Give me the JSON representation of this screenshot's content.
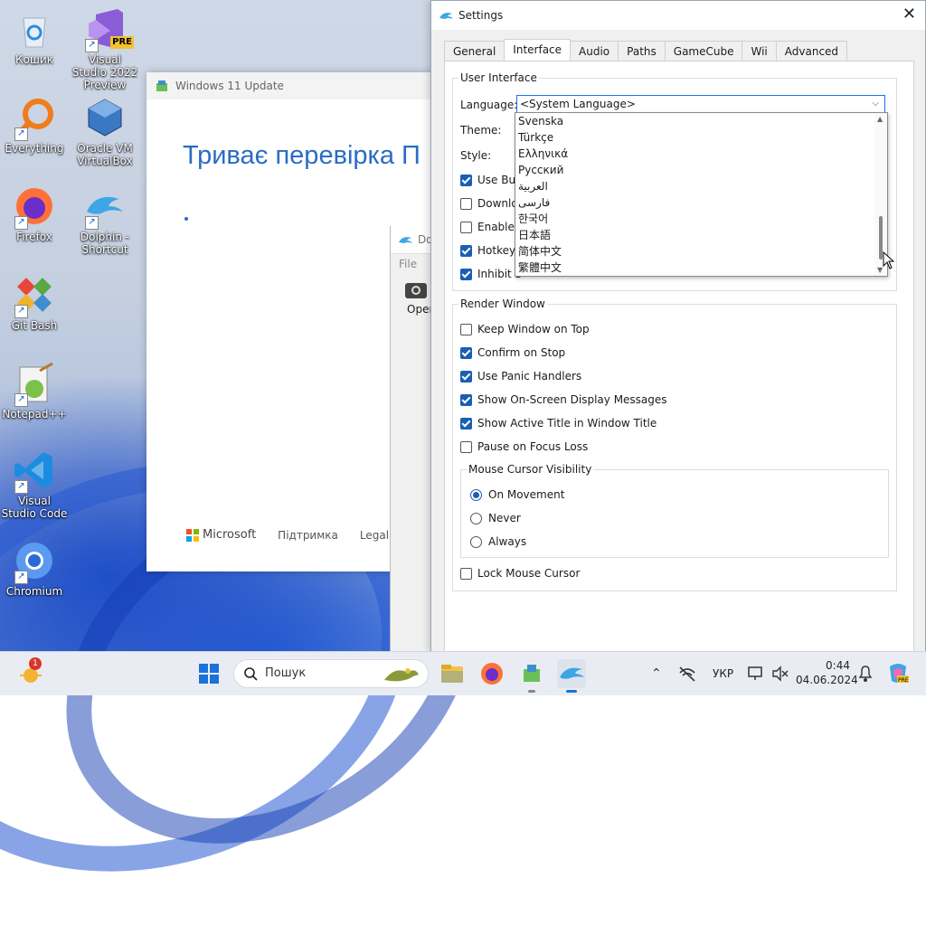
{
  "desktop": {
    "icons": [
      {
        "label": "Кошик",
        "icon": "recycle-bin-icon"
      },
      {
        "label": "Visual Studio 2022 Preview",
        "icon": "visual-studio-icon",
        "badge": "PRE"
      },
      {
        "label": "Everything",
        "icon": "everything-icon"
      },
      {
        "label": "Oracle VM VirtualBox",
        "icon": "virtualbox-icon"
      },
      {
        "label": "Firefox",
        "icon": "firefox-icon"
      },
      {
        "label": "Dolphin - Shortcut",
        "icon": "dolphin-icon"
      },
      {
        "label": "Git Bash",
        "icon": "git-bash-icon"
      },
      {
        "label": "Notepad++",
        "icon": "notepad-plus-plus-icon"
      },
      {
        "label": "Visual Studio Code",
        "icon": "vscode-icon"
      },
      {
        "label": "Chromium",
        "icon": "chromium-icon"
      }
    ]
  },
  "windows11_update": {
    "title": "Windows 11 Update",
    "heading": "Триває перевірка П",
    "footer": {
      "microsoft": "Microsoft",
      "support": "Підтримка",
      "legal": "Legal"
    }
  },
  "dolphin_window": {
    "title": "Do",
    "menu_file": "File",
    "open_label": "Oper"
  },
  "settings": {
    "title": "Settings",
    "tabs": [
      "General",
      "Interface",
      "Audio",
      "Paths",
      "GameCube",
      "Wii",
      "Advanced"
    ],
    "active_tab": "Interface",
    "user_interface": {
      "group_label": "User Interface",
      "language_label": "Language:",
      "language_value": "<System Language>",
      "theme_label": "Theme:",
      "style_label": "Style:",
      "checkboxes": [
        {
          "label": "Use Buil",
          "checked": true
        },
        {
          "label": "Downlo",
          "checked": false
        },
        {
          "label": "Enable D",
          "checked": false
        },
        {
          "label": "Hotkeys",
          "checked": true
        },
        {
          "label": "Inhibit S",
          "checked": true
        }
      ]
    },
    "language_dropdown": [
      "Svenska",
      "Türkçe",
      "Ελληνικά",
      "Русский",
      "العربية",
      "فارسی",
      "한국어",
      "日本語",
      "简体中文",
      "繁體中文"
    ],
    "render_window": {
      "group_label": "Render Window",
      "checkboxes": [
        {
          "label": "Keep Window on Top",
          "checked": false
        },
        {
          "label": "Confirm on Stop",
          "checked": true
        },
        {
          "label": "Use Panic Handlers",
          "checked": true
        },
        {
          "label": "Show On-Screen Display Messages",
          "checked": true
        },
        {
          "label": "Show Active Title in Window Title",
          "checked": true
        },
        {
          "label": "Pause on Focus Loss",
          "checked": false
        }
      ],
      "mouse_cursor": {
        "group_label": "Mouse Cursor Visibility",
        "options": [
          "On Movement",
          "Never",
          "Always"
        ],
        "selected": "On Movement"
      },
      "lock_mouse": {
        "label": "Lock Mouse Cursor",
        "checked": false
      }
    }
  },
  "taskbar": {
    "search_placeholder": "Пошук",
    "notification_count": "1",
    "language": "УКР",
    "time": "0:44",
    "date": "04.06.2024"
  }
}
